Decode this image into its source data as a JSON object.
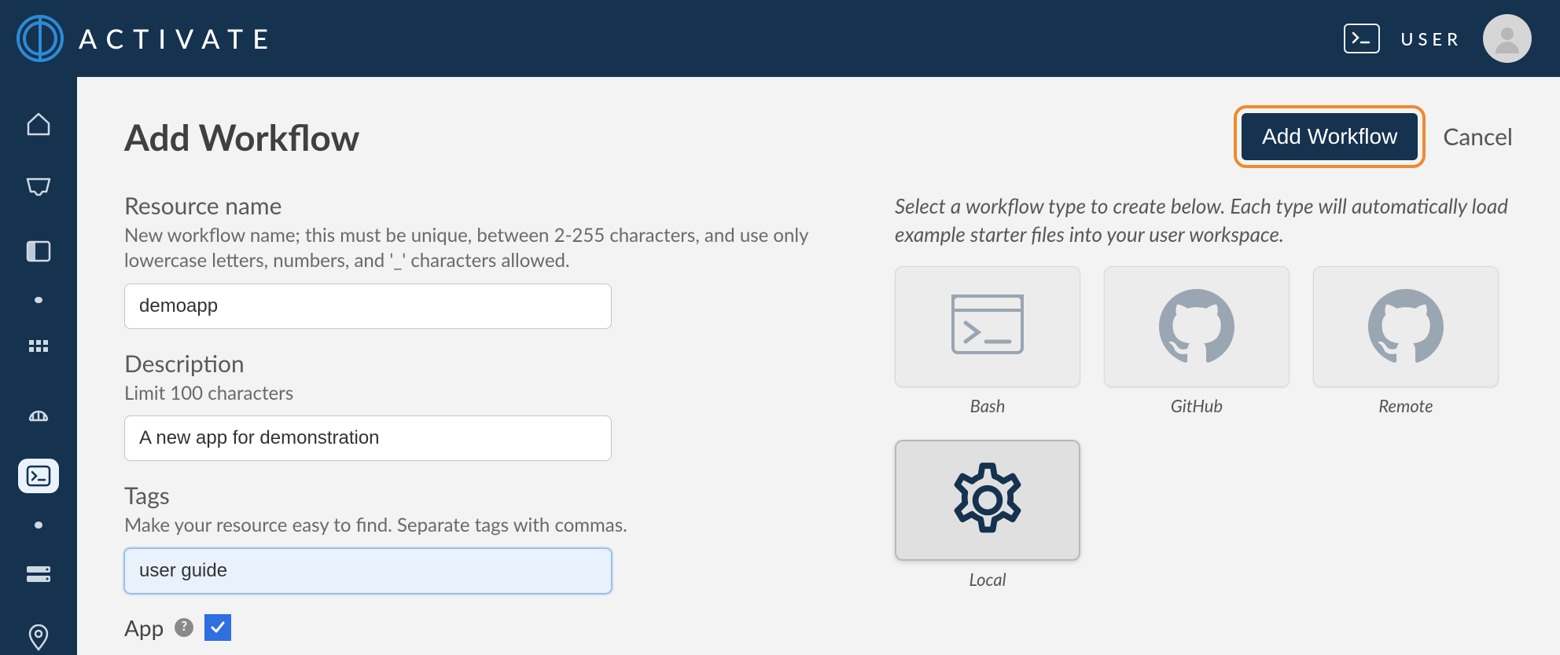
{
  "header": {
    "brand": "ACTIVATE",
    "user_label": "USER"
  },
  "page": {
    "title": "Add Workflow",
    "add_btn": "Add Workflow",
    "cancel": "Cancel"
  },
  "form": {
    "resource": {
      "label": "Resource name",
      "help": "New workflow name; this must be unique, between 2-255 characters, and use only lowercase letters, numbers, and '_' characters allowed.",
      "value": "demoapp"
    },
    "description": {
      "label": "Description",
      "help": "Limit 100 characters",
      "value": "A new app for demonstration"
    },
    "tags": {
      "label": "Tags",
      "help": "Make your resource easy to find. Separate tags with commas.",
      "value": "user guide"
    },
    "app": {
      "label": "App",
      "checked": true
    }
  },
  "picker": {
    "intro": "Select a workflow type to create below. Each type will automatically load example starter files into your user workspace.",
    "options": [
      {
        "id": "bash",
        "label": "Bash"
      },
      {
        "id": "github",
        "label": "GitHub"
      },
      {
        "id": "remote",
        "label": "Remote"
      },
      {
        "id": "local",
        "label": "Local"
      }
    ],
    "selected": "local"
  }
}
